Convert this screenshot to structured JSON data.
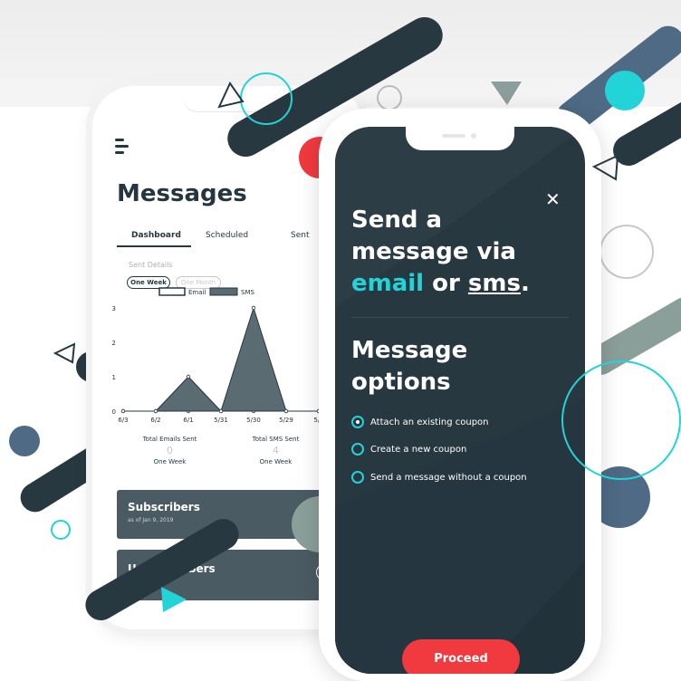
{
  "back_phone": {
    "title": "Messages",
    "tabs": [
      "Dashboard",
      "Scheduled",
      "Sent"
    ],
    "chart_caption": "Sent Details",
    "toggles": [
      "One Week",
      "One Month"
    ],
    "legend": [
      "Email",
      "SMS"
    ],
    "stats": [
      {
        "label": "Total Emails Sent",
        "value": "0",
        "period": "One Week"
      },
      {
        "label": "Total SMS Sent",
        "value": "4",
        "period": "One Week"
      }
    ],
    "subscribers": {
      "title": "Subscribers",
      "date": "as of Jan 9, 2019"
    },
    "unsubscribers": {
      "title": "Unsubscribers"
    }
  },
  "chart_data": {
    "type": "area",
    "categories": [
      "6/3",
      "6/2",
      "6/1",
      "5/31",
      "5/30",
      "5/29",
      "5/2"
    ],
    "series": [
      {
        "name": "Email",
        "values": [
          0,
          0,
          0,
          0,
          0,
          0,
          0
        ]
      },
      {
        "name": "SMS",
        "values": [
          0,
          0,
          1,
          0,
          3,
          0,
          0
        ]
      }
    ],
    "yticks": [
      "0",
      "1",
      "2",
      "3"
    ],
    "ylim": [
      0,
      3
    ]
  },
  "front_phone": {
    "close_icon": "close-icon",
    "heading_line1": "Send a",
    "heading_line2": "message via",
    "heading_email": "email",
    "heading_or": " or ",
    "heading_sms": "sms",
    "heading_dot": ".",
    "options_title_1": "Message",
    "options_title_2": "options",
    "options": [
      {
        "label": "Attach an existing coupon",
        "selected": true
      },
      {
        "label": "Create a new coupon",
        "selected": false
      },
      {
        "label": "Send a message without a coupon",
        "selected": false
      }
    ],
    "proceed": "Proceed"
  },
  "colors": {
    "accent": "#22d3d8",
    "primary_dark": "#283840",
    "cta": "#f03a3f",
    "slate": "#4b5b63"
  }
}
